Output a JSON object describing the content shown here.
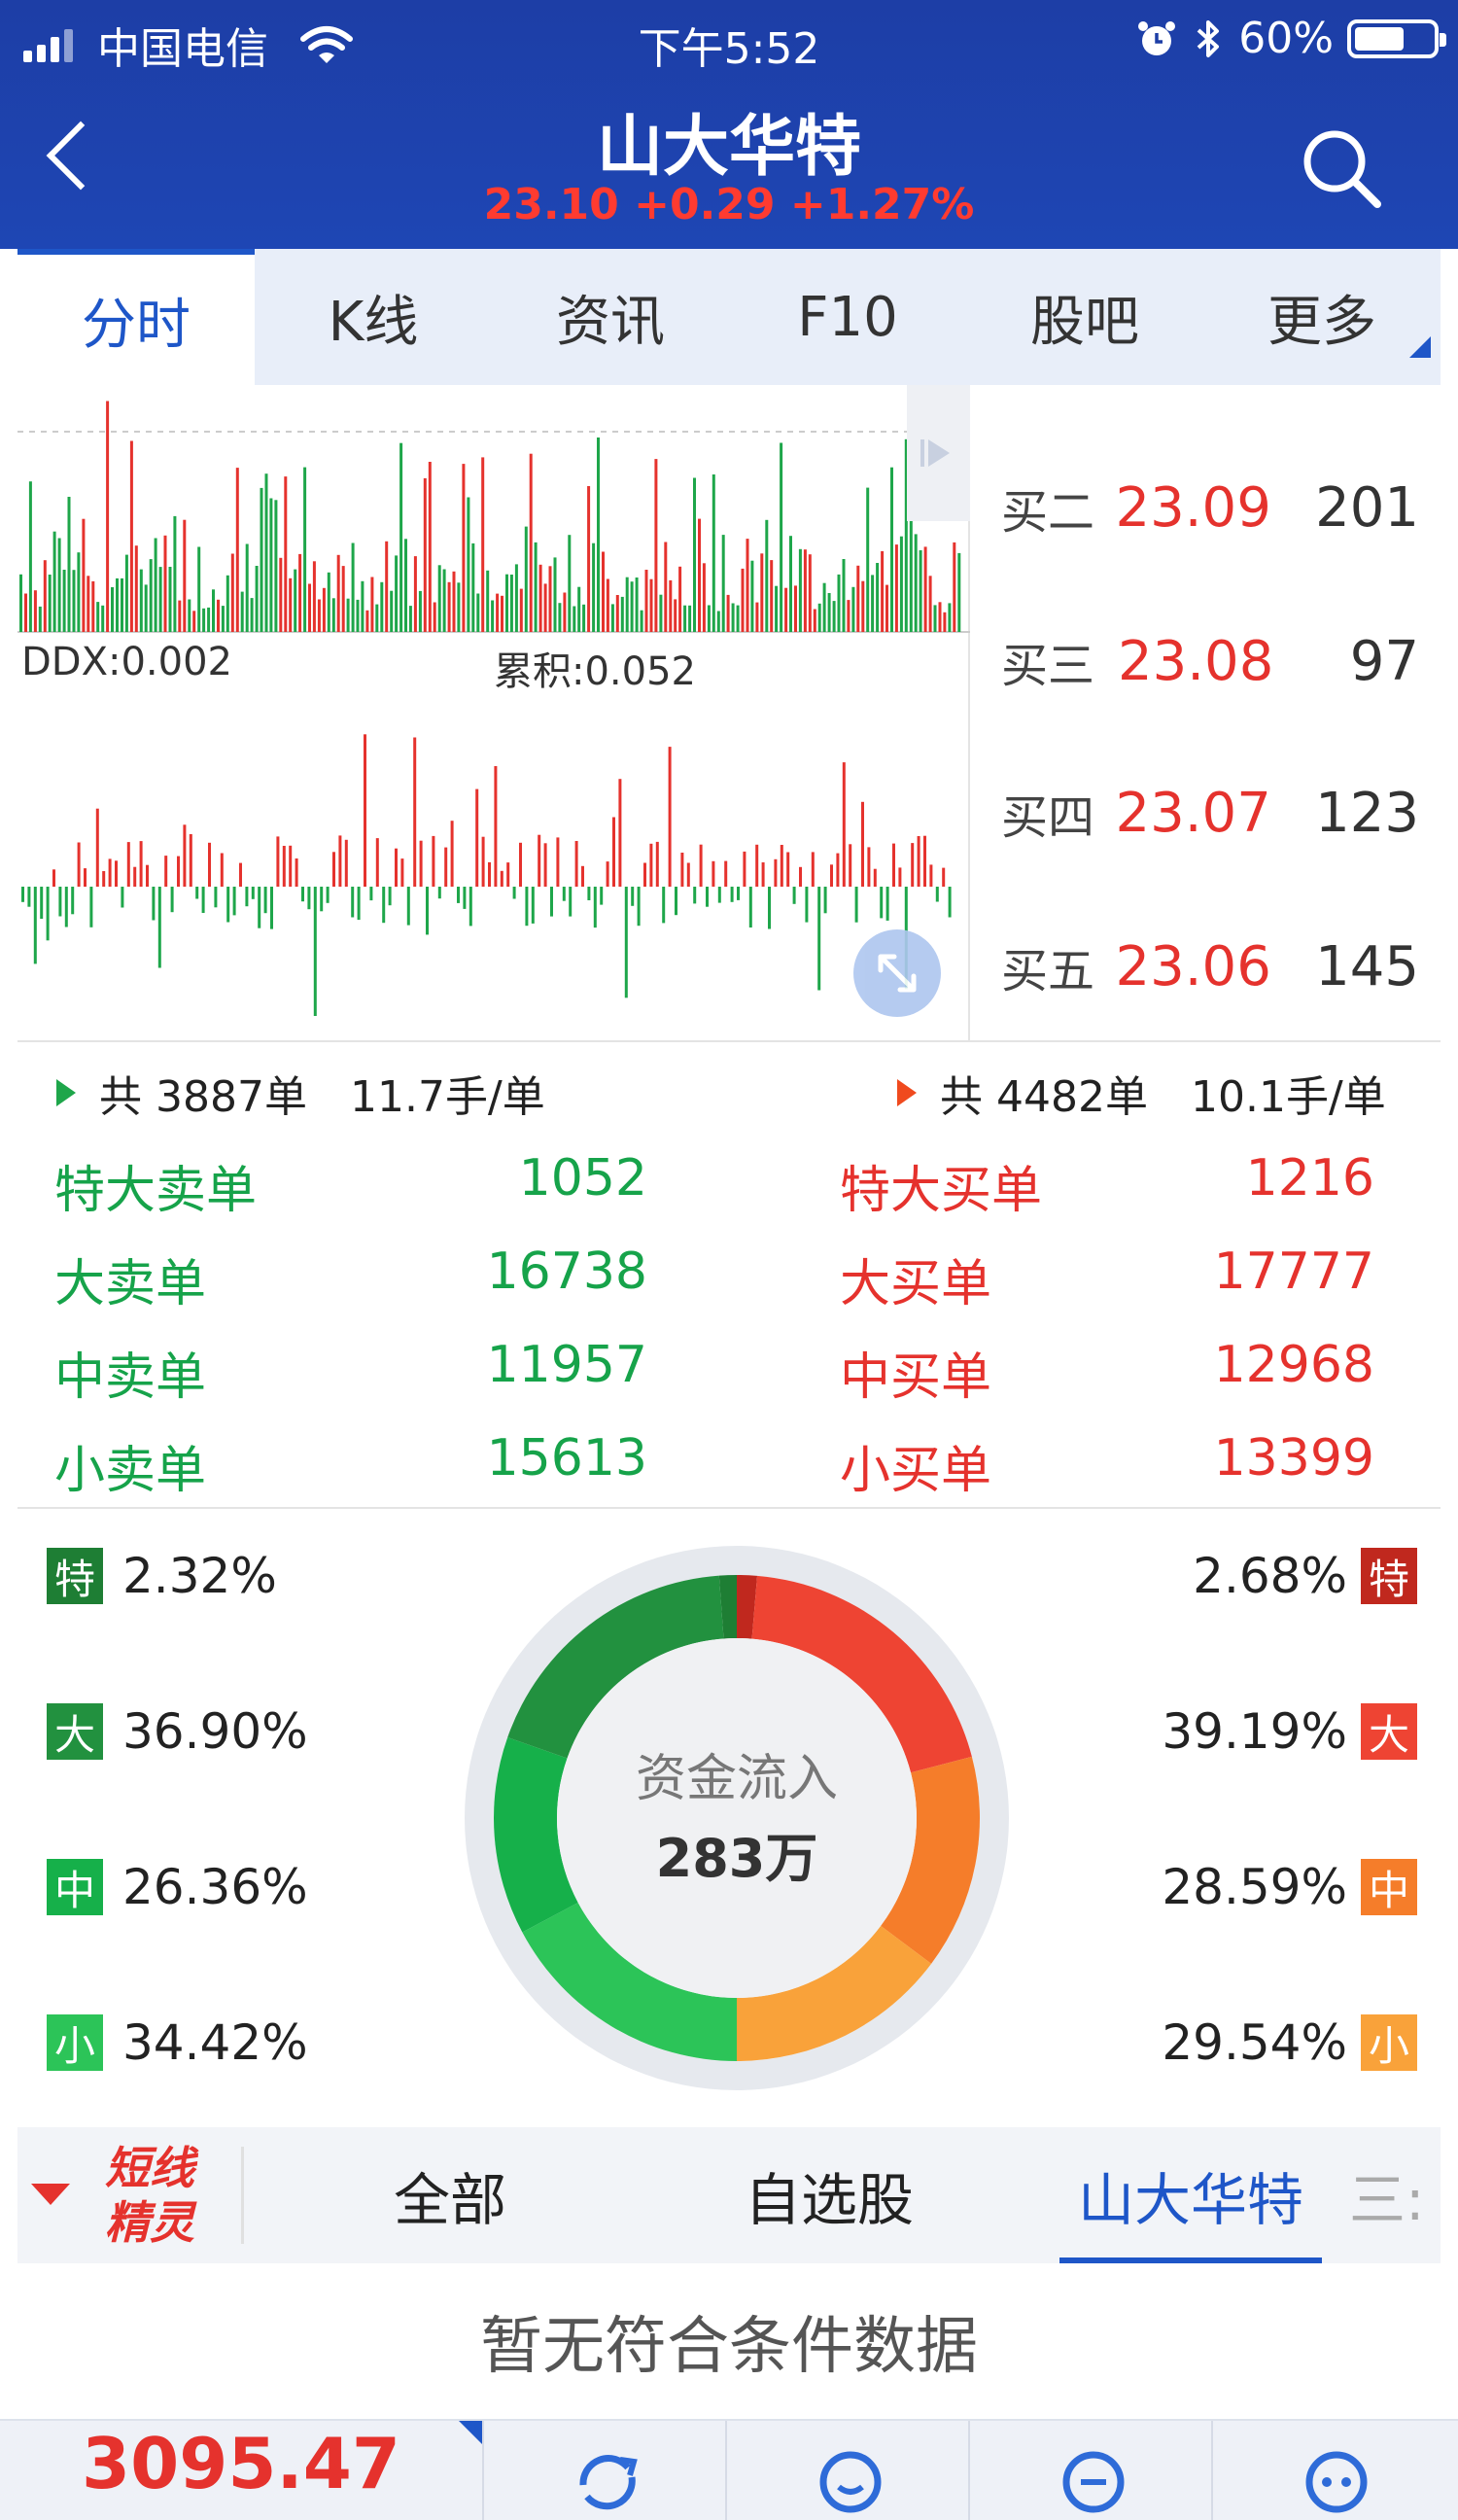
{
  "status_bar": {
    "carrier": "中国电信",
    "time": "下午5:52",
    "battery": "60%"
  },
  "header": {
    "title": "山大华特",
    "quote": "23.10 +0.29 +1.27%"
  },
  "tabs": [
    {
      "label": "分时",
      "active": true
    },
    {
      "label": "K线"
    },
    {
      "label": "资讯"
    },
    {
      "label": "F10"
    },
    {
      "label": "股吧"
    },
    {
      "label": "更多"
    }
  ],
  "indicator": {
    "ddx": "DDX:0.002",
    "accum": "累积:0.052"
  },
  "order_book": [
    {
      "label": "买二",
      "price": "23.09",
      "volume": "201"
    },
    {
      "label": "买三",
      "price": "23.08",
      "volume": "97"
    },
    {
      "label": "买四",
      "price": "23.07",
      "volume": "123"
    },
    {
      "label": "买五",
      "price": "23.06",
      "volume": "145"
    }
  ],
  "summary": {
    "sell_head": {
      "count": "共 3887单",
      "avg": "11.7手/单"
    },
    "buy_head": {
      "count": "共 4482单",
      "avg": "10.1手/单"
    },
    "sell": [
      {
        "name": "特大卖单",
        "value": "1052"
      },
      {
        "name": "大卖单",
        "value": "16738"
      },
      {
        "name": "中卖单",
        "value": "11957"
      },
      {
        "name": "小卖单",
        "value": "15613"
      }
    ],
    "buy": [
      {
        "name": "特大买单",
        "value": "1216"
      },
      {
        "name": "大买单",
        "value": "17777"
      },
      {
        "name": "中买单",
        "value": "12968"
      },
      {
        "name": "小买单",
        "value": "13399"
      }
    ]
  },
  "flow": {
    "center_label": "资金流入",
    "center_value": "283万",
    "sell": [
      {
        "badge": "特",
        "pct": "2.32%",
        "value": 2.32,
        "color": "#1e7e34"
      },
      {
        "badge": "大",
        "pct": "36.90%",
        "value": 36.9,
        "color": "#22913f"
      },
      {
        "badge": "中",
        "pct": "26.36%",
        "value": 26.36,
        "color": "#16b04a"
      },
      {
        "badge": "小",
        "pct": "34.42%",
        "value": 34.42,
        "color": "#2cc458"
      }
    ],
    "buy": [
      {
        "badge": "特",
        "pct": "2.68%",
        "value": 2.68,
        "color": "#c0281e"
      },
      {
        "badge": "大",
        "pct": "39.19%",
        "value": 39.19,
        "color": "#ee4433"
      },
      {
        "badge": "中",
        "pct": "28.59%",
        "value": 28.59,
        "color": "#f57d2a"
      },
      {
        "badge": "小",
        "pct": "29.54%",
        "value": 29.54,
        "color": "#f9a23a"
      }
    ]
  },
  "sub_tabs": {
    "logo": "短线精灵",
    "items": [
      {
        "label": "全部"
      },
      {
        "label": "自选股"
      },
      {
        "label": "山大华特",
        "active": true
      }
    ],
    "more": "三:"
  },
  "empty_message": "暂无符合条件数据",
  "bottom_bar": {
    "index_value": "3095.47"
  }
}
